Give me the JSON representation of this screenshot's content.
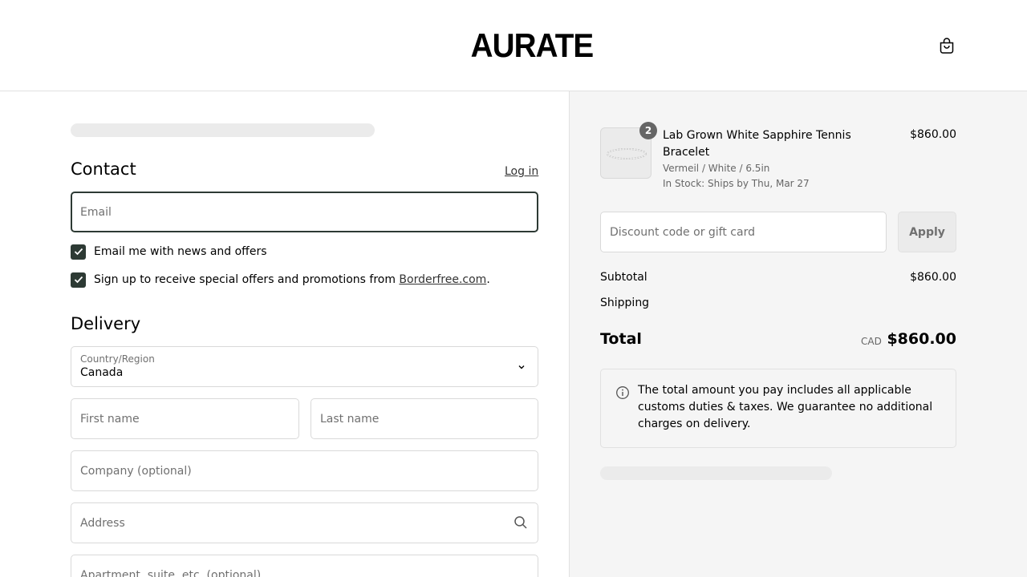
{
  "header": {
    "brand": "AURATE",
    "icons": {
      "cart": "shopping-bag-icon"
    }
  },
  "contact": {
    "title": "Contact",
    "login_link": "Log in",
    "email_placeholder": "Email",
    "news_checkbox_label": "Email me with news and offers",
    "borderfree_label_prefix": "Sign up to receive special offers and promotions from ",
    "borderfree_link": "Borderfree.com",
    "borderfree_label_suffix": "."
  },
  "delivery": {
    "title": "Delivery",
    "country_label": "Country/Region",
    "country_value": "Canada",
    "first_name_placeholder": "First name",
    "last_name_placeholder": "Last name",
    "company_placeholder": "Company (optional)",
    "address_placeholder": "Address",
    "apartment_placeholder": "Apartment, suite, etc. (optional)"
  },
  "order": {
    "item": {
      "quantity": "2",
      "name": "Lab Grown White Sapphire Tennis Bracelet",
      "variant": "Vermeil / White / 6.5in",
      "stock": "In Stock: Ships by Thu, Mar 27",
      "price": "$860.00"
    },
    "discount_placeholder": "Discount code or gift card",
    "apply_label": "Apply",
    "subtotal_label": "Subtotal",
    "subtotal_value": "$860.00",
    "shipping_label": "Shipping",
    "total_label": "Total",
    "total_currency": "CAD",
    "total_value": "$860.00",
    "duties_notice": "The total amount you pay includes all applicable customs duties & taxes. We guarantee no additional charges on delivery."
  },
  "colors": {
    "accent": "#2d3a34",
    "summary_background": "#f5f5f5",
    "border": "#d9d9d9"
  }
}
